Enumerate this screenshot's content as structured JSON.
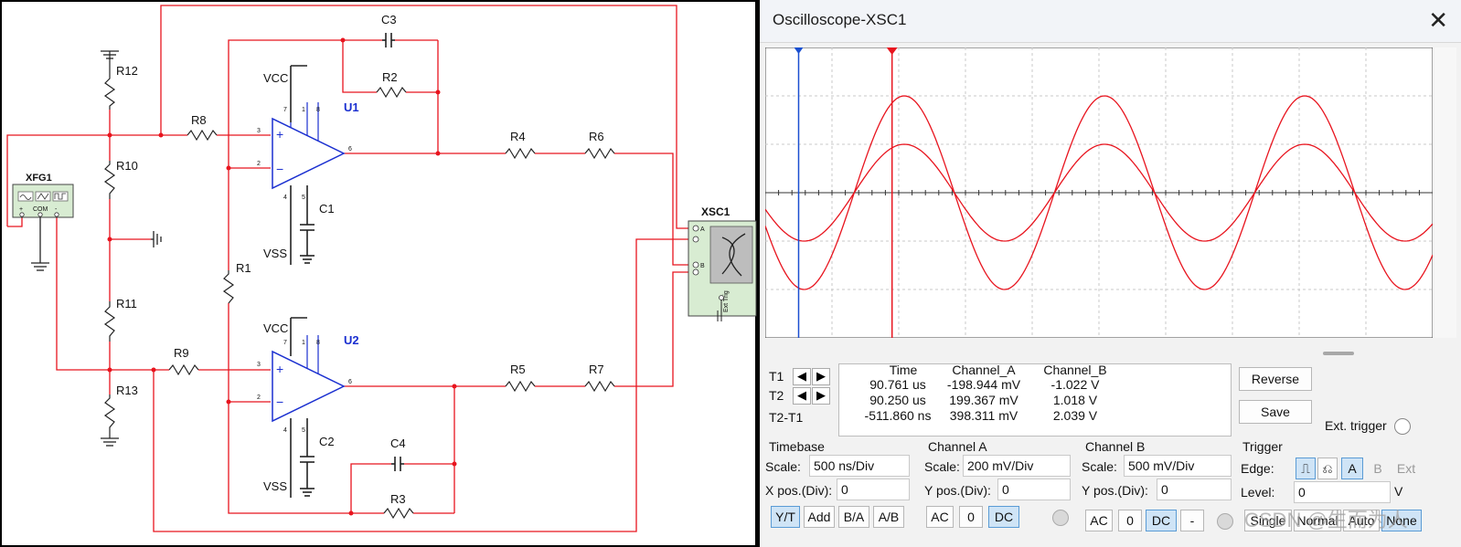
{
  "schematic": {
    "generator_label": "XFG1",
    "generator_terms": [
      "+",
      "COM",
      "-"
    ],
    "scope_label": "XSC1",
    "scope_terms": [
      "A",
      "B",
      "Ext Trig"
    ],
    "opamps": [
      {
        "label": "U1"
      },
      {
        "label": "U2"
      }
    ],
    "supply": {
      "vcc": "VCC",
      "vss": "VSS"
    },
    "pins": {
      "in_plus": "3",
      "in_minus": "2",
      "out": "6",
      "top1": "7",
      "top2": "1",
      "top3": "8",
      "bot1": "4",
      "bot2": "5"
    },
    "resistors": {
      "R1": "R1",
      "R2": "R2",
      "R3": "R3",
      "R4": "R4",
      "R5": "R5",
      "R6": "R6",
      "R7": "R7",
      "R8": "R8",
      "R9": "R9",
      "R10": "R10",
      "R11": "R11",
      "R12": "R12",
      "R13": "R13"
    },
    "capacitors": {
      "C1": "C1",
      "C2": "C2",
      "C3": "C3",
      "C4": "C4"
    },
    "colors": {
      "wire": "#e8141e",
      "opamp": "#1a2fd0",
      "instrument": "#d8ecd2"
    }
  },
  "oscilloscope": {
    "title": "Oscilloscope-XSC1",
    "close_icon": "close-icon",
    "measurements": {
      "headers": [
        "Time",
        "Channel_A",
        "Channel_B"
      ],
      "rows": [
        {
          "label": "T1",
          "time": "90.761 us",
          "a": "-198.944 mV",
          "b": "-1.022 V"
        },
        {
          "label": "T2",
          "time": "90.250 us",
          "a": "199.367 mV",
          "b": "1.018 V"
        },
        {
          "label": "T2-T1",
          "time": "-511.860 ns",
          "a": "398.311 mV",
          "b": "2.039 V"
        }
      ]
    },
    "buttons": {
      "reverse": "Reverse",
      "save": "Save",
      "ext_trigger": "Ext. trigger"
    },
    "timebase": {
      "title": "Timebase",
      "scale_label": "Scale:",
      "scale": "500 ns/Div",
      "xpos_label": "X pos.(Div):",
      "xpos": "0",
      "modes": [
        "Y/T",
        "Add",
        "B/A",
        "A/B"
      ]
    },
    "channel_a": {
      "title": "Channel A",
      "scale_label": "Scale:",
      "scale": "200 mV/Div",
      "ypos_label": "Y pos.(Div):",
      "ypos": "0",
      "coupling": [
        "AC",
        "0",
        "DC"
      ]
    },
    "channel_b": {
      "title": "Channel B",
      "scale_label": "Scale:",
      "scale": "500 mV/Div",
      "ypos_label": "Y pos.(Div):",
      "ypos": "0",
      "coupling": [
        "AC",
        "0",
        "DC",
        "-"
      ]
    },
    "trigger": {
      "title": "Trigger",
      "edge_label": "Edge:",
      "edge_buttons": [
        "A",
        "B",
        "Ext"
      ],
      "level_label": "Level:",
      "level": "0",
      "level_unit": "V",
      "modes": [
        "Single",
        "Normal",
        "Auto",
        "None"
      ]
    },
    "watermark": "CSDN @生而为人",
    "waveforms": {
      "channel_a": {
        "amplitude_div": 1.0,
        "period_div": 3.0,
        "phase_deg": 200
      },
      "channel_b": {
        "amplitude_div": 2.0,
        "period_div": 3.0,
        "phase_deg": 200
      },
      "cursor_t1_div": 0.5,
      "cursor_t2_div": 1.9,
      "colors": {
        "trace": "#e8141e",
        "cursor1": "#1a4fd0",
        "cursor2": "#e8141e",
        "grid": "#c8c8c8"
      }
    }
  }
}
